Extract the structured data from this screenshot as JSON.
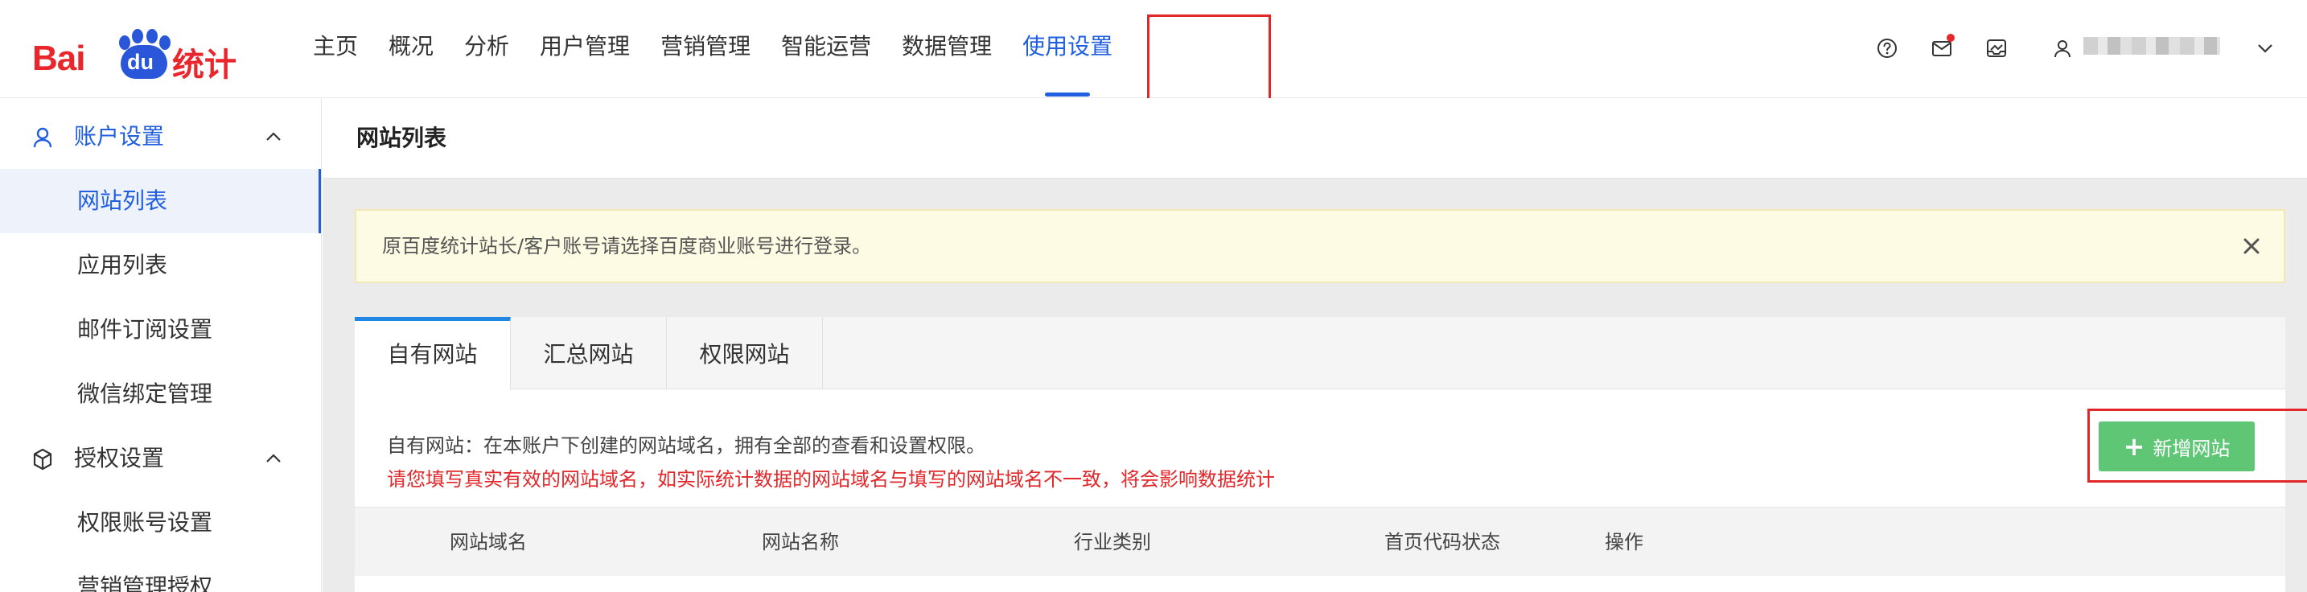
{
  "brand": {
    "logo_bai": "Bai",
    "logo_du": "du",
    "logo_tongji": "统计",
    "colors": {
      "red": "#e8262c",
      "blue": "#2a57d9",
      "accent": "#1f5fe0",
      "green": "#5fc676"
    }
  },
  "nav": {
    "items": [
      {
        "label": "主页"
      },
      {
        "label": "概况"
      },
      {
        "label": "分析"
      },
      {
        "label": "用户管理"
      },
      {
        "label": "营销管理"
      },
      {
        "label": "智能运营"
      },
      {
        "label": "数据管理"
      },
      {
        "label": "使用设置",
        "active": true
      }
    ]
  },
  "toolbar": {
    "icons": [
      "help-icon",
      "message-icon",
      "inbox-icon",
      "user-icon",
      "chevron-down-icon"
    ]
  },
  "sidebar": {
    "groups": [
      {
        "label": "账户设置",
        "icon": "user-icon",
        "expanded": true,
        "items": [
          {
            "label": "网站列表",
            "active": true
          },
          {
            "label": "应用列表"
          },
          {
            "label": "邮件订阅设置"
          },
          {
            "label": "微信绑定管理"
          }
        ]
      },
      {
        "label": "授权设置",
        "icon": "cube-icon",
        "expanded": true,
        "items": [
          {
            "label": "权限账号设置"
          },
          {
            "label": "营销管理授权"
          }
        ]
      }
    ]
  },
  "page": {
    "title": "网站列表",
    "notice": "原百度统计站长/客户账号请选择百度商业账号进行登录。",
    "tabs": [
      {
        "label": "自有网站",
        "active": true
      },
      {
        "label": "汇总网站"
      },
      {
        "label": "权限网站"
      }
    ],
    "description": "自有网站：在本账户下创建的网站域名，拥有全部的查看和设置权限。",
    "warning": "请您填写真实有效的网站域名，如实际统计数据的网站域名与填写的网站域名不一致，将会影响数据统计",
    "add_button": "新增网站",
    "table_headers": [
      "网站域名",
      "网站名称",
      "行业类别",
      "首页代码状态",
      "操作"
    ]
  }
}
